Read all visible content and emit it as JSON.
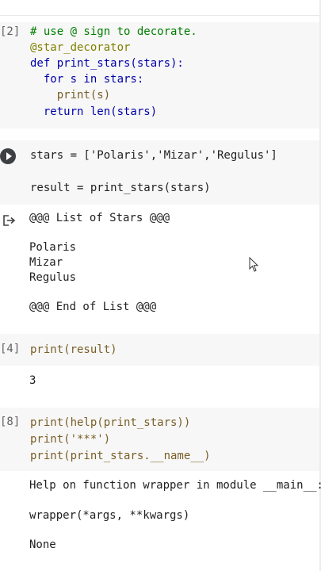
{
  "cells": [
    {
      "exec_count": "[2]",
      "lines": [
        "# use @ sign to decorate.",
        "@star_decorator",
        "def print_stars(stars):",
        "  for s in stars:",
        "    print(s)",
        "  return len(stars)"
      ]
    },
    {
      "exec_count": "",
      "lines": [
        "stars = ['Polaris','Mizar','Regulus']",
        "result = print_stars(stars)"
      ],
      "outputs": [
        "@@@ List of Stars @@@",
        "Polaris",
        "Mizar",
        "Regulus",
        "@@@ End of List @@@"
      ]
    },
    {
      "exec_count": "[4]",
      "lines": [
        "print(result)"
      ],
      "outputs": [
        "3"
      ]
    },
    {
      "exec_count": "[8]",
      "lines": [
        "print(help(print_stars))",
        "print('***')",
        "print(print_stars.__name__)"
      ],
      "outputs": [
        "Help on function wrapper in module __main__:",
        "wrapper(*args, **kwargs)",
        "None"
      ]
    }
  ],
  "icons": {
    "run": "play-circle-icon",
    "output": "output-redirect-icon",
    "cursor": "mouse-pointer-icon"
  }
}
